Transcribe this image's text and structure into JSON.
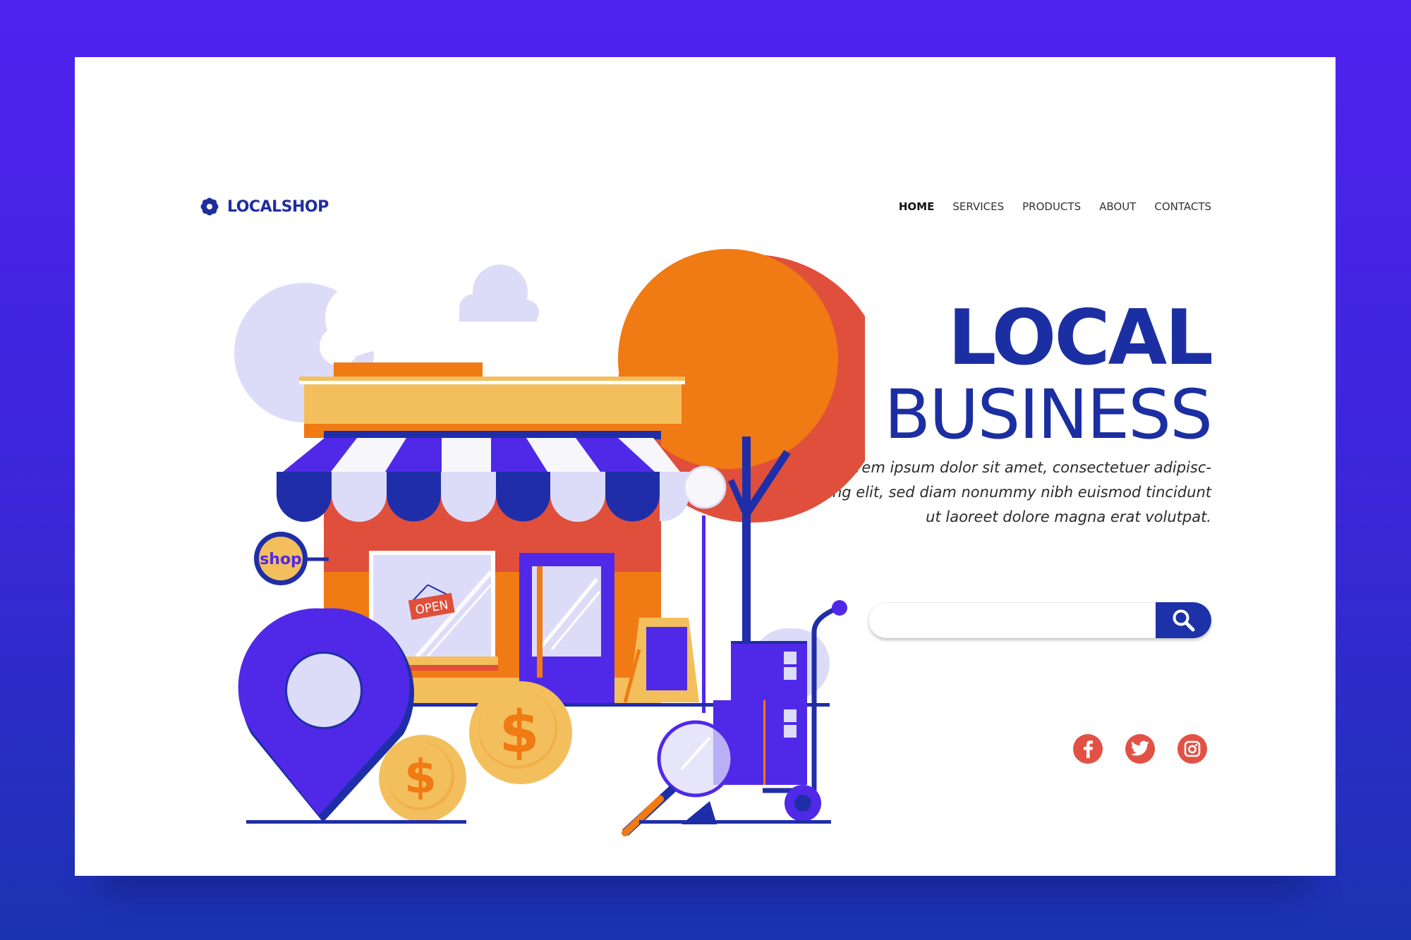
{
  "brand": {
    "name": "LOCALSHOP",
    "icon": "flower-icon"
  },
  "nav": {
    "items": [
      {
        "label": "HOME",
        "active": true
      },
      {
        "label": "SERVICES"
      },
      {
        "label": "PRODUCTS"
      },
      {
        "label": "ABOUT"
      },
      {
        "label": "CONTACTS"
      }
    ]
  },
  "hero": {
    "title_line1": "LOCAL",
    "title_line2": "BUSINESS",
    "description": "Lorem ipsum dolor sit amet, consectetuer adipisc-ing elit, sed diam nonummy nibh euismod tincidunt ut laoreet dolore magna erat volutpat."
  },
  "search": {
    "value": "",
    "placeholder": "",
    "icon": "search-icon"
  },
  "social": [
    "facebook-icon",
    "twitter-icon",
    "instagram-icon"
  ],
  "illustration": {
    "shop_sign": "shop",
    "door_sign": "OPEN",
    "coin_symbol": "$"
  },
  "colors": {
    "background_top": "#5022ef",
    "background_bottom": "#1a33b0",
    "brand_blue": "#1c2fa2",
    "violet": "#5029e8",
    "orange": "#f07a14",
    "red": "#e04f3b",
    "yellow": "#f3bf5c",
    "lavender": "#dddcf8"
  }
}
